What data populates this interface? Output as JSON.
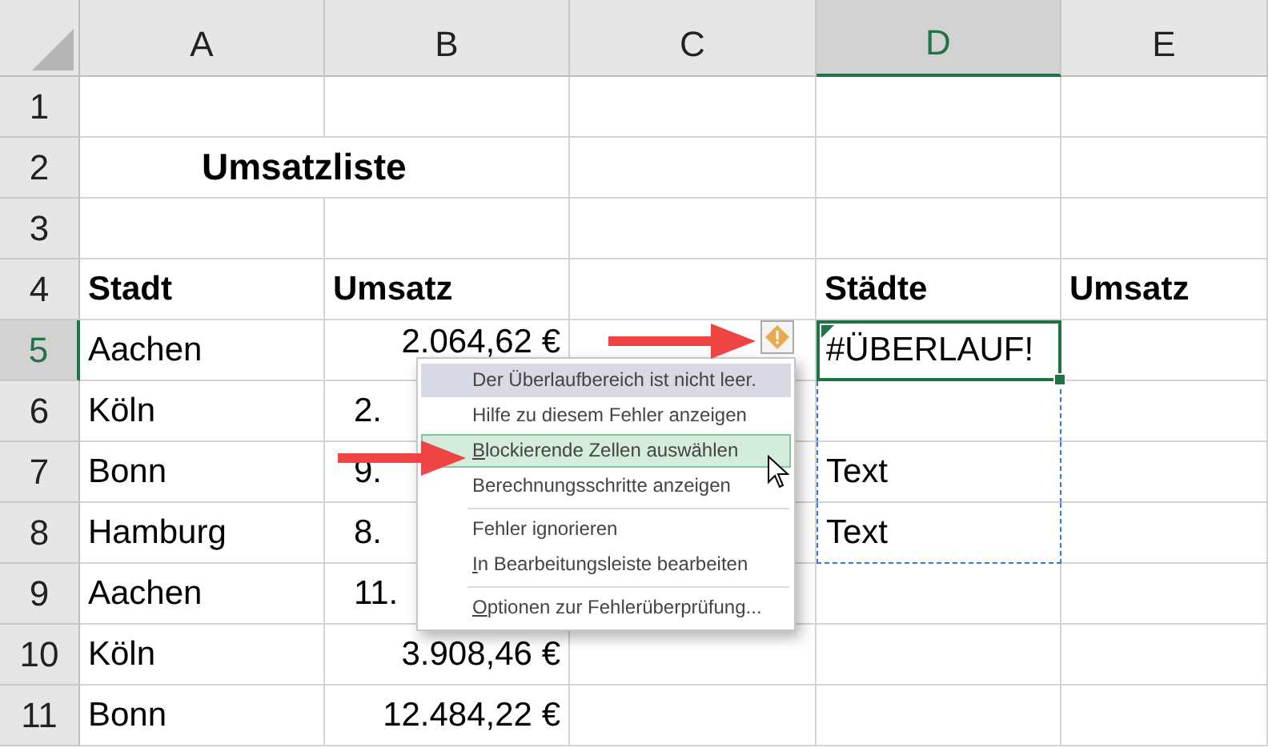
{
  "columns": [
    {
      "label": "A",
      "selected": false
    },
    {
      "label": "B",
      "selected": false
    },
    {
      "label": "C",
      "selected": false
    },
    {
      "label": "D",
      "selected": true
    },
    {
      "label": "E",
      "selected": false
    }
  ],
  "rows": [
    {
      "header": "1",
      "selected": false,
      "cells": {}
    },
    {
      "header": "2",
      "selected": false,
      "cells": {
        "A": {
          "text": "Umsatzliste",
          "kind": "title"
        }
      }
    },
    {
      "header": "3",
      "selected": false,
      "cells": {}
    },
    {
      "header": "4",
      "selected": false,
      "cells": {
        "A": {
          "text": "Stadt",
          "kind": "heading"
        },
        "B": {
          "text": "Umsatz",
          "kind": "heading"
        },
        "D": {
          "text": "Städte",
          "kind": "heading"
        },
        "E": {
          "text": "Umsatz",
          "kind": "heading"
        }
      }
    },
    {
      "header": "5",
      "selected": true,
      "cells": {
        "A": {
          "text": "Aachen",
          "kind": "text"
        },
        "B": {
          "text": "2.064,62 €",
          "kind": "number"
        },
        "D": {
          "text": "#ÜBERLAUF!",
          "kind": "text",
          "selected": true,
          "error_flag": true,
          "spill": true
        }
      }
    },
    {
      "header": "6",
      "selected": false,
      "cells": {
        "A": {
          "text": "Köln",
          "kind": "text"
        },
        "B": {
          "text": "2.",
          "kind": "cut"
        },
        "D": {
          "kind": "empty",
          "spill": true
        }
      }
    },
    {
      "header": "7",
      "selected": false,
      "cells": {
        "A": {
          "text": "Bonn",
          "kind": "text"
        },
        "B": {
          "text": "9.",
          "kind": "cut"
        },
        "D": {
          "text": "Text",
          "kind": "text",
          "spill": true
        }
      }
    },
    {
      "header": "8",
      "selected": false,
      "cells": {
        "A": {
          "text": "Hamburg",
          "kind": "text"
        },
        "B": {
          "text": "8.",
          "kind": "cut"
        },
        "D": {
          "text": "Text",
          "kind": "text",
          "spill": true
        }
      }
    },
    {
      "header": "9",
      "selected": false,
      "cells": {
        "A": {
          "text": "Aachen",
          "kind": "text"
        },
        "B": {
          "text": "11.",
          "kind": "cut"
        }
      }
    },
    {
      "header": "10",
      "selected": false,
      "cells": {
        "A": {
          "text": "Köln",
          "kind": "text"
        },
        "B": {
          "text": "3.908,46 €",
          "kind": "number"
        }
      }
    },
    {
      "header": "11",
      "selected": false,
      "cells": {
        "A": {
          "text": "Bonn",
          "kind": "text"
        },
        "B": {
          "text": "12.484,22 €",
          "kind": "number"
        }
      }
    }
  ],
  "error_menu": {
    "items": [
      {
        "label": "Der Überlaufbereich ist nicht leer.",
        "kind": "header",
        "selected": false,
        "accel": false,
        "separator_before": false
      },
      {
        "label": "Hilfe zu diesem Fehler anzeigen",
        "kind": "item",
        "selected": false,
        "accel": false,
        "separator_before": false
      },
      {
        "label": "Blockierende Zellen auswählen",
        "kind": "item",
        "selected": true,
        "accel": true,
        "separator_before": false
      },
      {
        "label": "Berechnungsschritte anzeigen",
        "kind": "item",
        "selected": false,
        "accel": false,
        "separator_before": false
      },
      {
        "label": "Fehler ignorieren",
        "kind": "item",
        "selected": false,
        "accel": false,
        "separator_before": true
      },
      {
        "label": "In Bearbeitungsleiste bearbeiten",
        "kind": "item",
        "selected": false,
        "accel": true,
        "separator_before": false
      },
      {
        "label": "Optionen zur Fehlerüberprüfung...",
        "kind": "item",
        "selected": false,
        "accel": true,
        "separator_before": true
      }
    ]
  }
}
